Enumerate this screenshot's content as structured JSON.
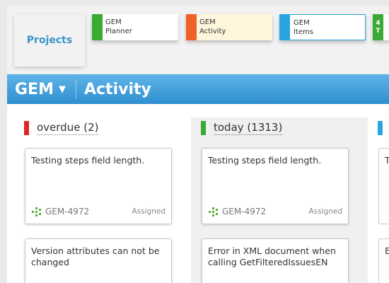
{
  "nav": {
    "projects_label": "Projects",
    "apps": [
      {
        "line1": "GEM",
        "line2": "Planner",
        "color": "#3aaa35",
        "bg": "#ffffff"
      },
      {
        "line1": "GEM",
        "line2": "Activity",
        "color": "#f0612a",
        "bg": "#fdf5dc"
      },
      {
        "line1": "GEM",
        "line2": "Items",
        "color": "#2aa4df",
        "bg": "#ffffff"
      },
      {
        "line1": "4",
        "line2": "T",
        "color": "#3aaa35",
        "bg": "#ffffff"
      }
    ]
  },
  "header": {
    "project": "GEM",
    "caret": "▼",
    "title": "Activity",
    "colors": {
      "top": "#5fb4e8",
      "bottom": "#2e8fcf"
    }
  },
  "columns": [
    {
      "title": "overdue (2)",
      "color": "#e02424",
      "cards": [
        {
          "text": "Testing steps field length.",
          "key": "GEM-4972",
          "status": "Assigned"
        },
        {
          "text": "Version attributes can not be changed"
        }
      ]
    },
    {
      "title": "today (1313)",
      "color": "#3aaa35",
      "cards": [
        {
          "text": "Testing steps field length.",
          "key": "GEM-4972",
          "status": "Assigned"
        },
        {
          "text": "Error in XML document when calling GetFilteredIssuesEN"
        }
      ]
    },
    {
      "title": "",
      "color": "#2aa4df",
      "cards": [
        {
          "text": "T"
        },
        {
          "text": "E"
        }
      ]
    }
  ],
  "icons": {
    "item_key": "task-key-icon",
    "caret": "caret-down-icon"
  }
}
